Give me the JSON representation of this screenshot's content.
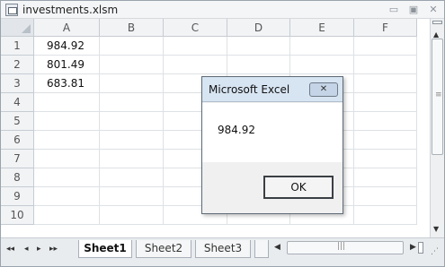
{
  "window": {
    "title": "investments.xlsm",
    "controls": {
      "minimize": "▭",
      "maximize": "▣",
      "close": "✕"
    }
  },
  "sheet": {
    "columns": [
      "A",
      "B",
      "C",
      "D",
      "E",
      "F"
    ],
    "rows": [
      "1",
      "2",
      "3",
      "4",
      "5",
      "6",
      "7",
      "8",
      "9",
      "10"
    ],
    "cells": {
      "A1": "984.92",
      "A2": "801.49",
      "A3": "683.81"
    }
  },
  "tabs": {
    "items": [
      "Sheet1",
      "Sheet2",
      "Sheet3"
    ],
    "active": "Sheet1",
    "nav": {
      "first": "◂◂",
      "prev": "◂",
      "next": "▸",
      "last": "▸▸"
    }
  },
  "dialog": {
    "title": "Microsoft Excel",
    "message": "984.92",
    "ok_label": "OK",
    "close_label": "✕"
  },
  "icons": {
    "doc": "excel-document-icon",
    "scroll_up": "▲",
    "scroll_down": "▼",
    "scroll_left": "◀",
    "scroll_right": "▶",
    "grip": "≡",
    "hgrip": "|||",
    "resize": "⋰"
  }
}
